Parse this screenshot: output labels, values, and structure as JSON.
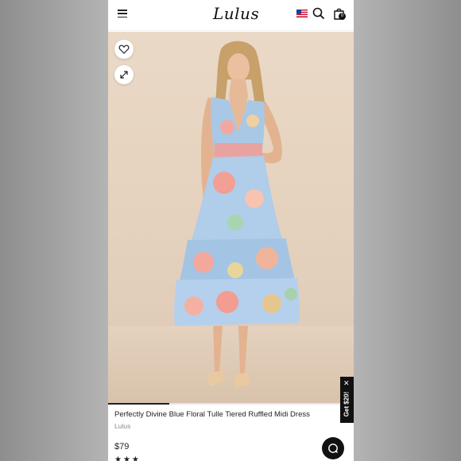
{
  "header": {
    "logo_text": "Lulus",
    "cart_count": "0",
    "icons": [
      "menu-icon",
      "us-flag-icon",
      "search-icon",
      "shopping-bag-icon"
    ]
  },
  "gallery": {
    "icons": [
      "heart-icon",
      "expand-icon"
    ],
    "progress_fraction": 0.25
  },
  "promo": {
    "label": "Get $20!"
  },
  "product": {
    "title": "Perfectly Divine Blue Floral Tulle Tiered Ruffled Midi Dress",
    "brand": "Lulus",
    "price": "$79",
    "rating_stars": "★★★"
  },
  "chat": {
    "icon": "chat-icon"
  },
  "colors": {
    "dress_blue": "#a9c9e8",
    "background_beige": "#e6d4c0",
    "accent_black": "#111111"
  }
}
